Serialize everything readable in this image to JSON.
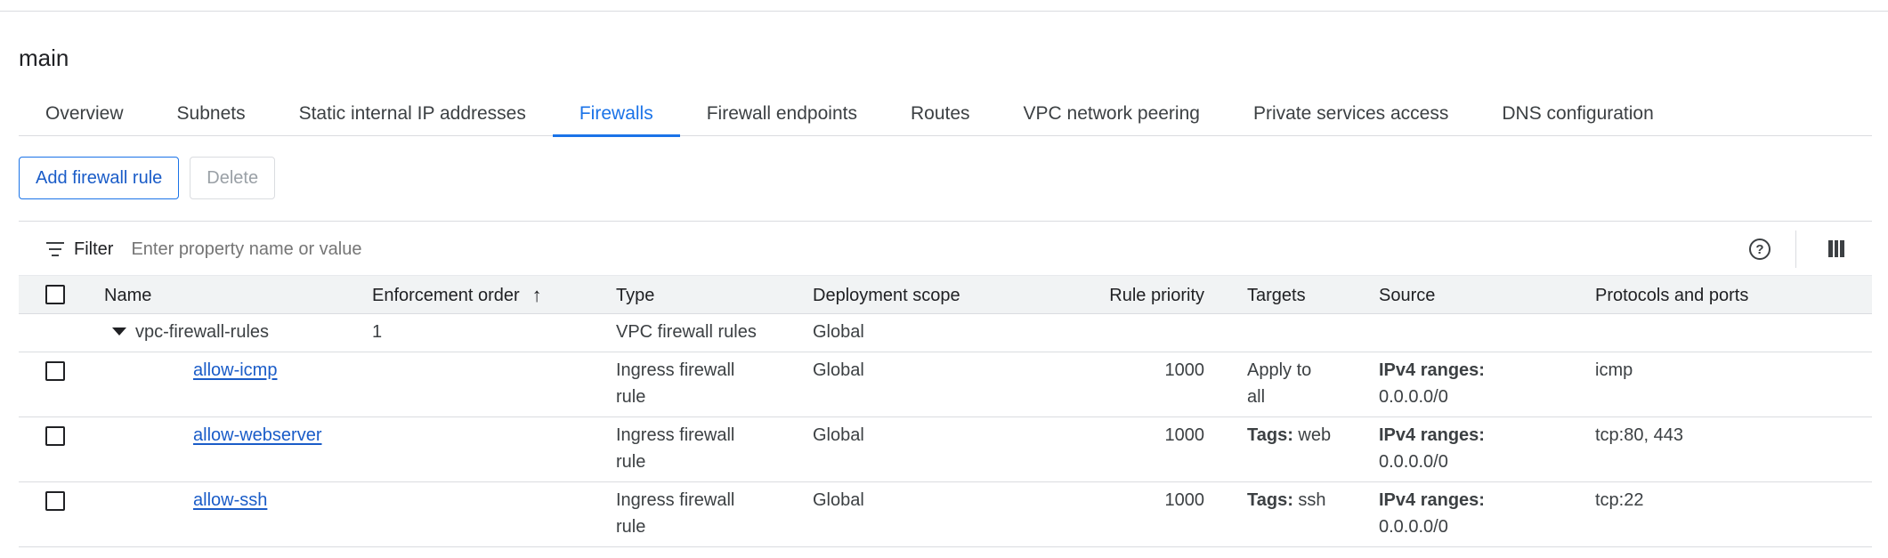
{
  "page_title": "main",
  "tabs": [
    {
      "label": "Overview"
    },
    {
      "label": "Subnets"
    },
    {
      "label": "Static internal IP addresses"
    },
    {
      "label": "Firewalls",
      "active": true
    },
    {
      "label": "Firewall endpoints"
    },
    {
      "label": "Routes"
    },
    {
      "label": "VPC network peering"
    },
    {
      "label": "Private services access"
    },
    {
      "label": "DNS configuration"
    }
  ],
  "actions": {
    "add_label": "Add firewall rule",
    "delete_label": "Delete"
  },
  "filter": {
    "label": "Filter",
    "placeholder": "Enter property name or value"
  },
  "table": {
    "headers": {
      "name": "Name",
      "enforcement_order": "Enforcement order",
      "type": "Type",
      "deployment_scope": "Deployment scope",
      "rule_priority": "Rule priority",
      "targets": "Targets",
      "source": "Source",
      "protocols": "Protocols and ports"
    },
    "group": {
      "name": "vpc-firewall-rules",
      "order": "1",
      "type": "VPC firewall rules",
      "scope": "Global"
    },
    "rows": [
      {
        "name": "allow-icmp",
        "type_l1": "Ingress firewall",
        "type_l2": "rule",
        "scope": "Global",
        "priority": "1000",
        "targets_label": "",
        "targets_l1": "Apply to",
        "targets_l2": "all",
        "source_label": "IPv4 ranges:",
        "source_value": "0.0.0.0/0",
        "protocols": "icmp"
      },
      {
        "name": "allow-webserver",
        "type_l1": "Ingress firewall",
        "type_l2": "rule",
        "scope": "Global",
        "priority": "1000",
        "targets_label": "Tags:",
        "targets_l1": "web",
        "targets_l2": "",
        "source_label": "IPv4 ranges:",
        "source_value": "0.0.0.0/0",
        "protocols": "tcp:80, 443"
      },
      {
        "name": "allow-ssh",
        "type_l1": "Ingress firewall",
        "type_l2": "rule",
        "scope": "Global",
        "priority": "1000",
        "targets_label": "Tags:",
        "targets_l1": "ssh",
        "targets_l2": "",
        "source_label": "IPv4 ranges:",
        "source_value": "0.0.0.0/0",
        "protocols": "tcp:22"
      }
    ]
  },
  "icons": {
    "filter": "filter-icon",
    "help": "help-icon",
    "columns": "column-display-icon",
    "sort": "arrow-up-icon",
    "expand": "caret-down-icon"
  },
  "colors": {
    "accent": "#1a73e8",
    "link": "#1a5cc8",
    "header_bg": "#f1f3f4"
  }
}
